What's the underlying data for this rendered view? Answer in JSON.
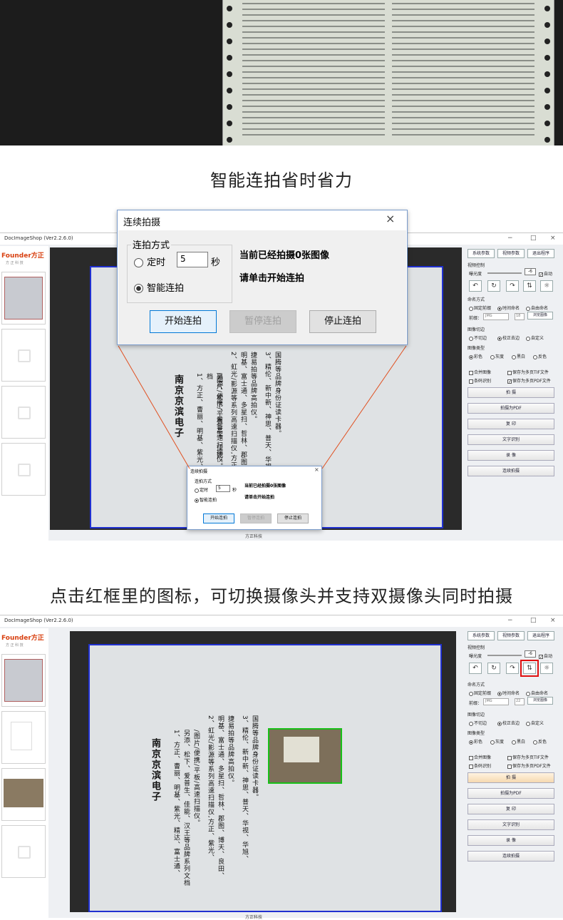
{
  "captions": {
    "smart_capture": "智能连拍省时省力",
    "camera_switch": "点击红框里的图标，可切换摄像头并支持双摄像头同时拍摄"
  },
  "app": {
    "window_title": "DocImageShop (Ver2.2.6.0)",
    "window_controls": [
      "−",
      "□",
      "×"
    ],
    "brand": "Founder方正",
    "brand_sub": "方 正 科 技",
    "footer": "方正科技"
  },
  "document": {
    "title": "南京京滨电子",
    "lines": [
      "1、方正、曹丽、明基、紫光、精达、富士通、",
      "另添、松下、爱普生、佳能、汉王等品牌系列文档",
      "/图片/便携/平板/高速扫描仪。",
      "2、虹光/影源等系列高速扫描仪,方正、紫光、",
      "明基、富士通、多星扫、哲林、郡图、博天、良田、",
      "捷易拍等品牌高拍仪。",
      "3、精伦、新中新、神思、普天、华视、华旭、",
      "国腾等品牌身份证读卡器。"
    ]
  },
  "panel": {
    "top_buttons": [
      "系统参数",
      "视频参数",
      "退出程序"
    ],
    "video_control": "视频控制",
    "exposure": "曝光度",
    "exposure_value": "-6",
    "auto": "自动",
    "naming": "命名方式",
    "naming_options": [
      "固定前缀",
      "时间命名",
      "自由命名"
    ],
    "prefix_label": "前缀：",
    "prefix_value": "JMG",
    "counter_value_1": "18",
    "counter_value_2": "22",
    "browse": "浏览图像",
    "crop": "图像切边",
    "crop_options": [
      "不切边",
      "校正去边",
      "自定义"
    ],
    "image_type": "图像类型",
    "image_type_options": [
      "彩色",
      "灰度",
      "黑白",
      "反色"
    ],
    "merge": "合并图像",
    "save_tif": "保存为多页TIF文件",
    "barcode": "条码识别",
    "save_pdf": "保存为多页PDF文件",
    "actions": [
      "拍    摄",
      "拍摄为PDF",
      "复    印",
      "文字识别",
      "录    像",
      "连续拍摄"
    ]
  },
  "dialog": {
    "title": "连续拍摄",
    "close": "×",
    "group_label": "连拍方式",
    "timed_label": "定时",
    "timed_value": "5",
    "seconds": "秒",
    "smart_label": "智能连拍",
    "status": "当前已经拍摄0张图像",
    "hint": "请单击开始连拍",
    "buttons": [
      "开始连拍",
      "暂停连拍",
      "停止连拍"
    ]
  },
  "colors": {
    "highlight": "#e01010",
    "paper_border": "#2030d0",
    "dialog_border": "#7a9ccc",
    "zoom_lines": "#e05020",
    "camera_frame": "#18c018"
  }
}
